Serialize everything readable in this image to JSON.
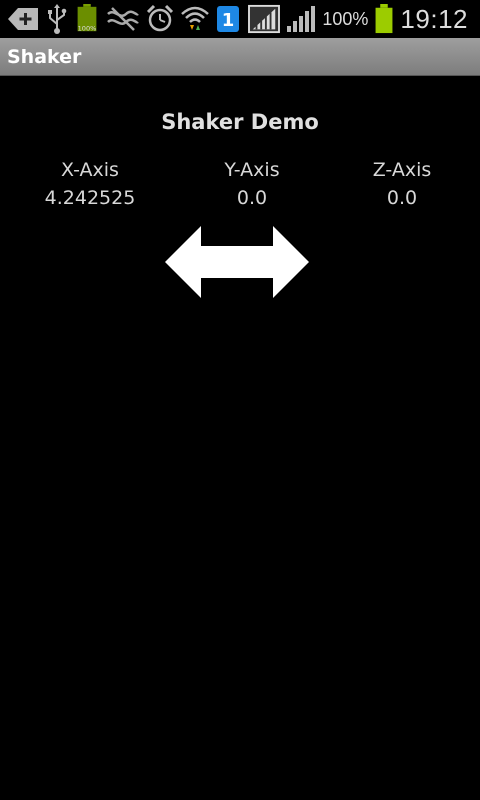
{
  "status_bar": {
    "icons_left": [
      "add-icon",
      "usb-icon",
      "battery-full-icon",
      "signal-off-icon",
      "alarm-icon",
      "wifi-icon",
      "notification-badge-icon"
    ],
    "notification_count": "1",
    "battery_small_label": "100%",
    "battery_percent": "100%",
    "time": "19:12"
  },
  "app": {
    "title": "Shaker"
  },
  "main": {
    "demo_title": "Shaker Demo",
    "axes": [
      {
        "label": "X-Axis",
        "value": "4.242525"
      },
      {
        "label": "Y-Axis",
        "value": "0.0"
      },
      {
        "label": "Z-Axis",
        "value": "0.0"
      }
    ],
    "direction_icon": "double-arrow-horizontal-icon"
  },
  "colors": {
    "background": "#000000",
    "title_bar": "#8a8a8a",
    "text": "#d8d8d8",
    "battery_green": "#9ccc00",
    "badge_blue": "#1e88e5"
  }
}
